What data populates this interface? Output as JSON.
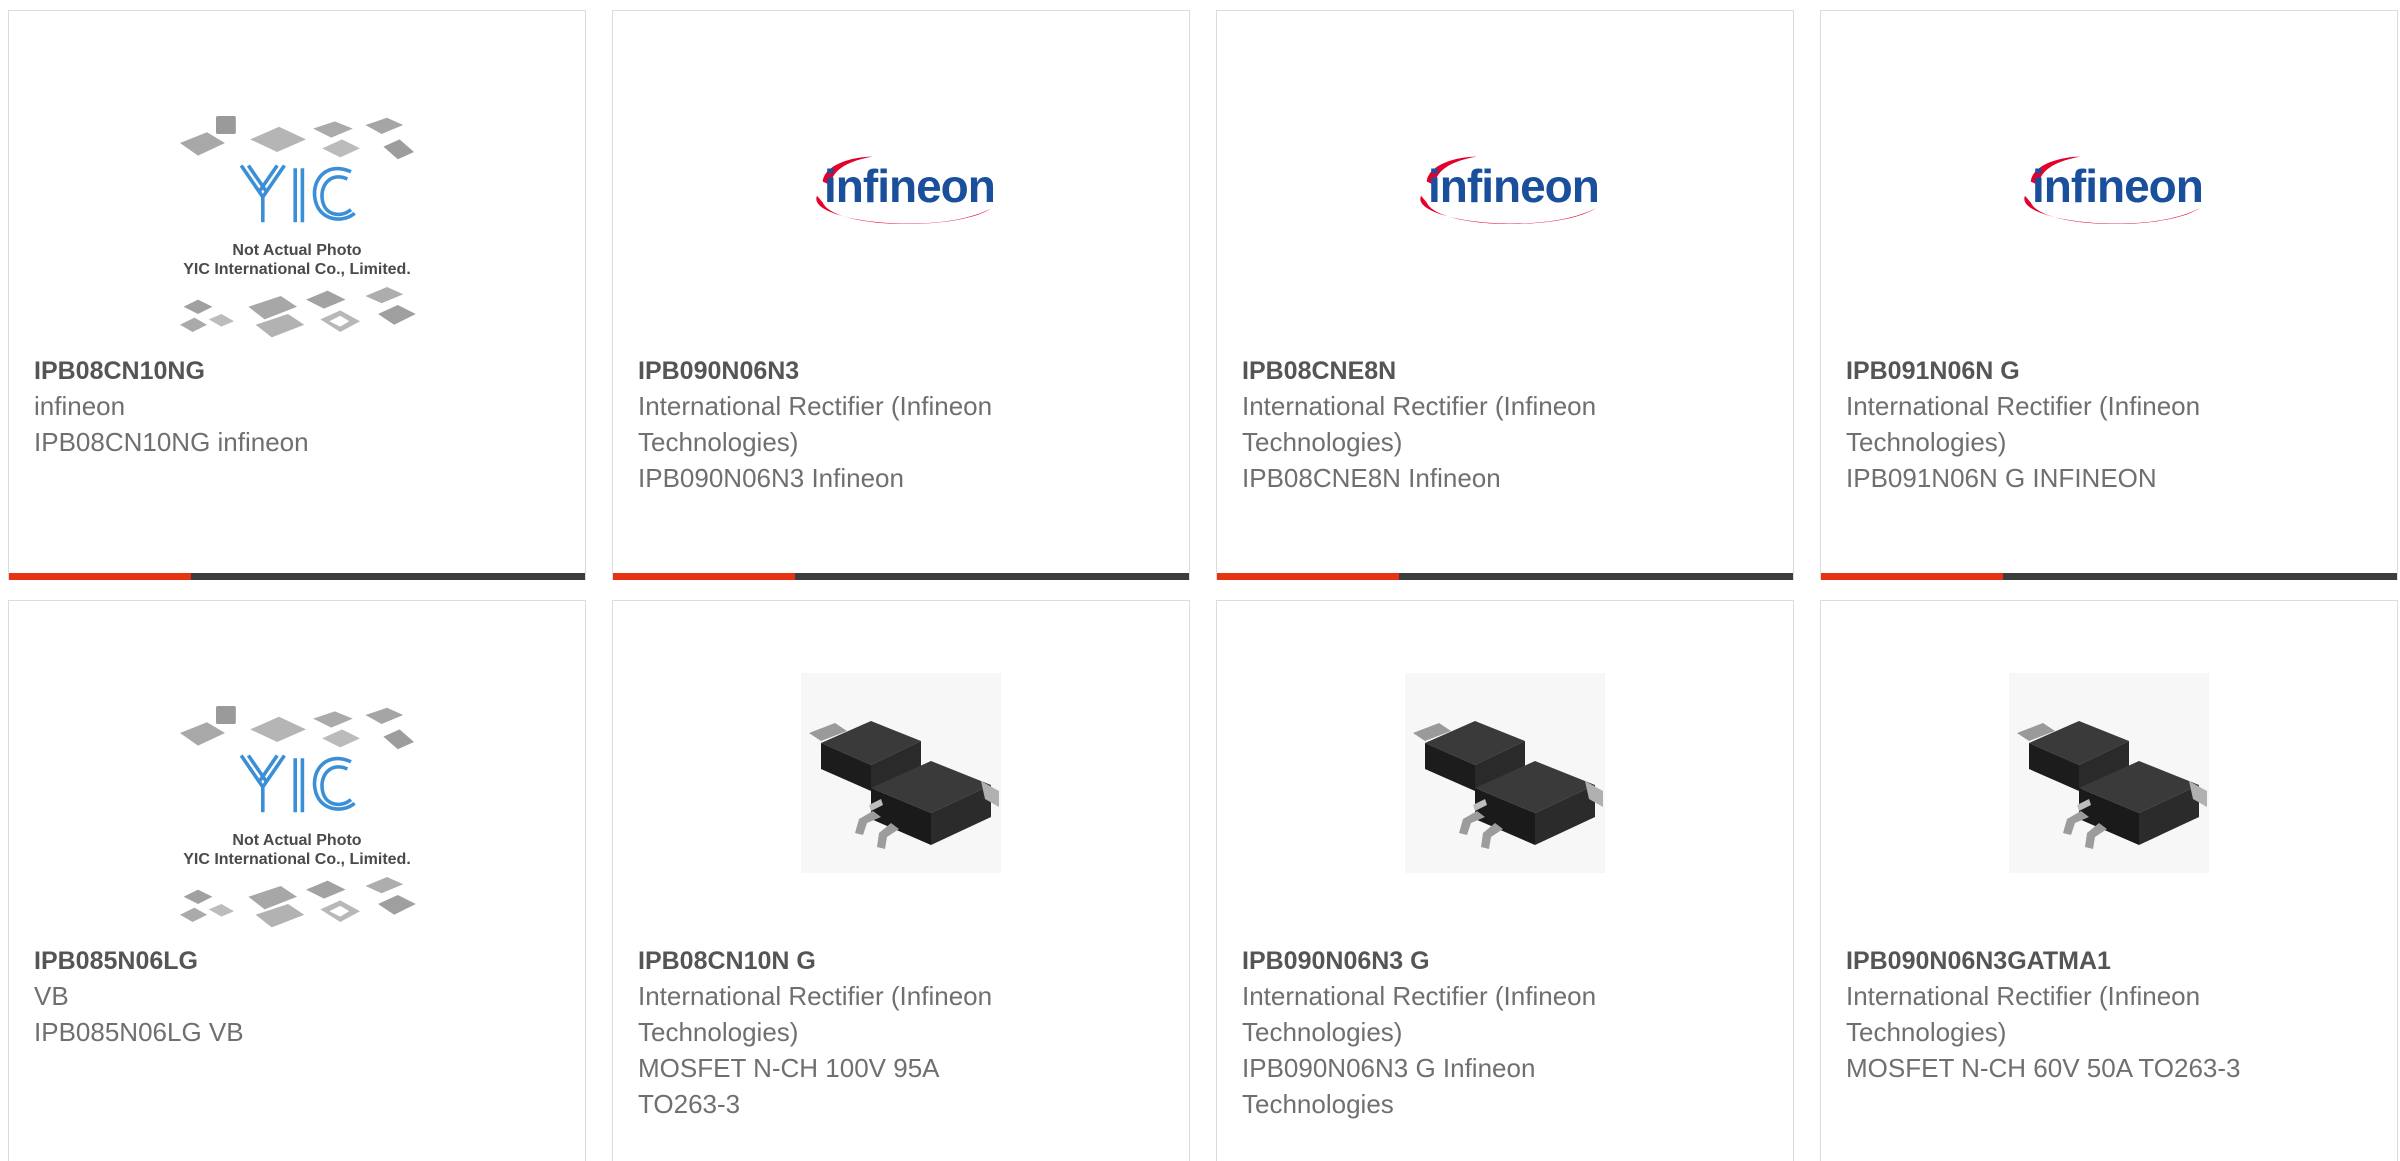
{
  "colors": {
    "accent": "#e63312",
    "bar_dark": "#3d3d3d",
    "infineon_blue": "#1a4f9c",
    "infineon_red": "#e4002b",
    "yic_blue": "#3b8fd6"
  },
  "products": [
    {
      "part_number": "IPB08CN10NG",
      "manufacturer": "infineon",
      "description": "IPB08CN10NG infineon",
      "image": "yic-placeholder"
    },
    {
      "part_number": "IPB090N06N3",
      "manufacturer": "International Rectifier (Infineon Technologies)",
      "description": "IPB090N06N3 Infineon",
      "image": "infineon-logo"
    },
    {
      "part_number": "IPB08CNE8N",
      "manufacturer": "International Rectifier (Infineon Technologies)",
      "description": "IPB08CNE8N Infineon",
      "image": "infineon-logo"
    },
    {
      "part_number": "IPB091N06N G",
      "manufacturer": "International Rectifier (Infineon Technologies)",
      "description": "IPB091N06N G INFINEON",
      "image": "infineon-logo"
    },
    {
      "part_number": "IPB085N06LG",
      "manufacturer": "VB",
      "description": "IPB085N06LG VB",
      "image": "yic-placeholder"
    },
    {
      "part_number": "IPB08CN10N G",
      "manufacturer": "International Rectifier (Infineon Technologies)",
      "description": "MOSFET N-CH 100V 95A TO263-3",
      "image": "to263-package"
    },
    {
      "part_number": "IPB090N06N3 G",
      "manufacturer": "International Rectifier (Infineon Technologies)",
      "description": "IPB090N06N3 G Infineon Technologies",
      "image": "to263-package"
    },
    {
      "part_number": "IPB090N06N3GATMA1",
      "manufacturer": "International Rectifier (Infineon Technologies)",
      "description": "MOSFET N-CH 60V 50A TO263-3",
      "image": "to263-package"
    }
  ],
  "placeholder": {
    "brand": "YIC",
    "line1": "Not Actual Photo",
    "line2": "YIC International Co., Limited."
  },
  "infineon_logo_text": "infineon"
}
